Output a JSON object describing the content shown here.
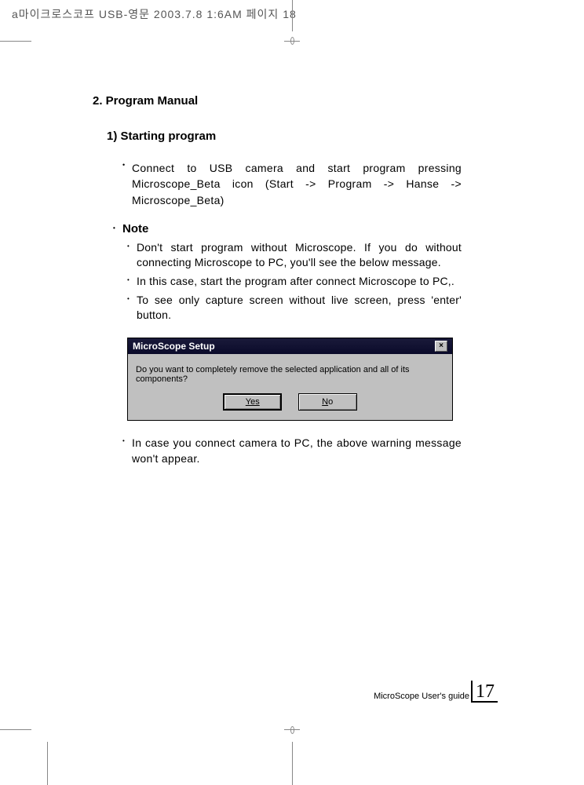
{
  "header": "a마이크로스코프 USB-영문  2003.7.8 1:6AM 페이지 18",
  "section_title": "2. Program Manual",
  "subsection_title": "1) Starting program",
  "main_bullet": "Connect to USB camera and start program pressing Microscope_Beta icon (Start -> Program -> Hanse -> Microscope_Beta)",
  "note_heading": "Note",
  "notes": [
    "Don't start program without Microscope. If you do without connecting Microscope to PC, you'll see the below message.",
    "In this case, start the program after connect Microscope to PC,.",
    "To see only capture screen without live screen, press 'enter' button."
  ],
  "dialog": {
    "title": "MicroScope Setup",
    "body": "Do you want to completely remove the selected application and all of its components?",
    "yes": "Yes",
    "no": "No",
    "close": "×"
  },
  "post_dialog": "In case you connect camera to PC, the above warning message won't appear.",
  "footer_text": "MicroScope User's guide",
  "page_num": "17"
}
